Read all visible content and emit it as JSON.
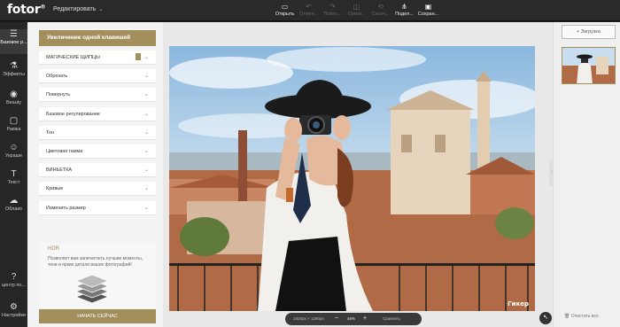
{
  "app": {
    "logo": "fotor",
    "logo_mark": "®",
    "edit_menu": "Редактировать"
  },
  "toolbar": [
    {
      "icon": "open-icon",
      "glyph": "▭",
      "label": "Открыть",
      "enabled": true
    },
    {
      "icon": "undo-icon",
      "glyph": "↶",
      "label": "Отмен...",
      "enabled": false
    },
    {
      "icon": "redo-icon",
      "glyph": "↷",
      "label": "Повто...",
      "enabled": false
    },
    {
      "icon": "compare-icon",
      "glyph": "◫",
      "label": "Ориги...",
      "enabled": false
    },
    {
      "icon": "reset-icon",
      "glyph": "⟲",
      "label": "Сконч...",
      "enabled": false
    },
    {
      "icon": "share-icon",
      "glyph": "⋔",
      "label": "Подел...",
      "enabled": true
    },
    {
      "icon": "save-icon",
      "glyph": "▣",
      "label": "Сохран...",
      "enabled": true
    }
  ],
  "rail": [
    {
      "icon": "basic-icon",
      "glyph": "☰",
      "label": "Базовое р..."
    },
    {
      "icon": "effects-icon",
      "glyph": "⚗",
      "label": "Эффекты"
    },
    {
      "icon": "beauty-icon",
      "glyph": "◉",
      "label": "Beauty"
    },
    {
      "icon": "frame-icon",
      "glyph": "▢",
      "label": "Рамка"
    },
    {
      "icon": "sticker-icon",
      "glyph": "☺",
      "label": "Украше"
    },
    {
      "icon": "text-icon",
      "glyph": "T",
      "label": "Текст"
    },
    {
      "icon": "cloud-icon",
      "glyph": "☁",
      "label": "Облако"
    },
    {
      "icon": "help-icon",
      "glyph": "?",
      "label": "центр по..."
    },
    {
      "icon": "settings-icon",
      "glyph": "⚙",
      "label": "Настройки"
    }
  ],
  "panel": {
    "header": "Увеличение одной клавишей",
    "items": [
      "МАГИЧЕСКИЕ ЩИПЦЫ",
      "Обрезать",
      "Повернуть",
      "Базовое регулирование",
      "Тон",
      "Цветовая гамма",
      "ВИНЬЕТКА",
      "Кривые",
      "Изменить размер"
    ],
    "hdr": {
      "title": "HDR",
      "description": "Позволяет вам запечатлеть лучшие моменты, тени и яркие детали ваших фотографий!",
      "button": "НАЧАТЬ СЕЙЧАС"
    }
  },
  "canvas": {
    "watermark": "Гикер",
    "zoom": {
      "size": "1920px × 1280px",
      "minus": "−",
      "value": "46%",
      "plus": "+",
      "compare": "Сравнить"
    }
  },
  "right": {
    "upload": "+ Загрузка",
    "clear_all": "Очистить все"
  },
  "colors": {
    "accent": "#a28f5c",
    "topbar": "#2a2a2a",
    "rail": "#262626",
    "panel": "#f3f3f3"
  }
}
